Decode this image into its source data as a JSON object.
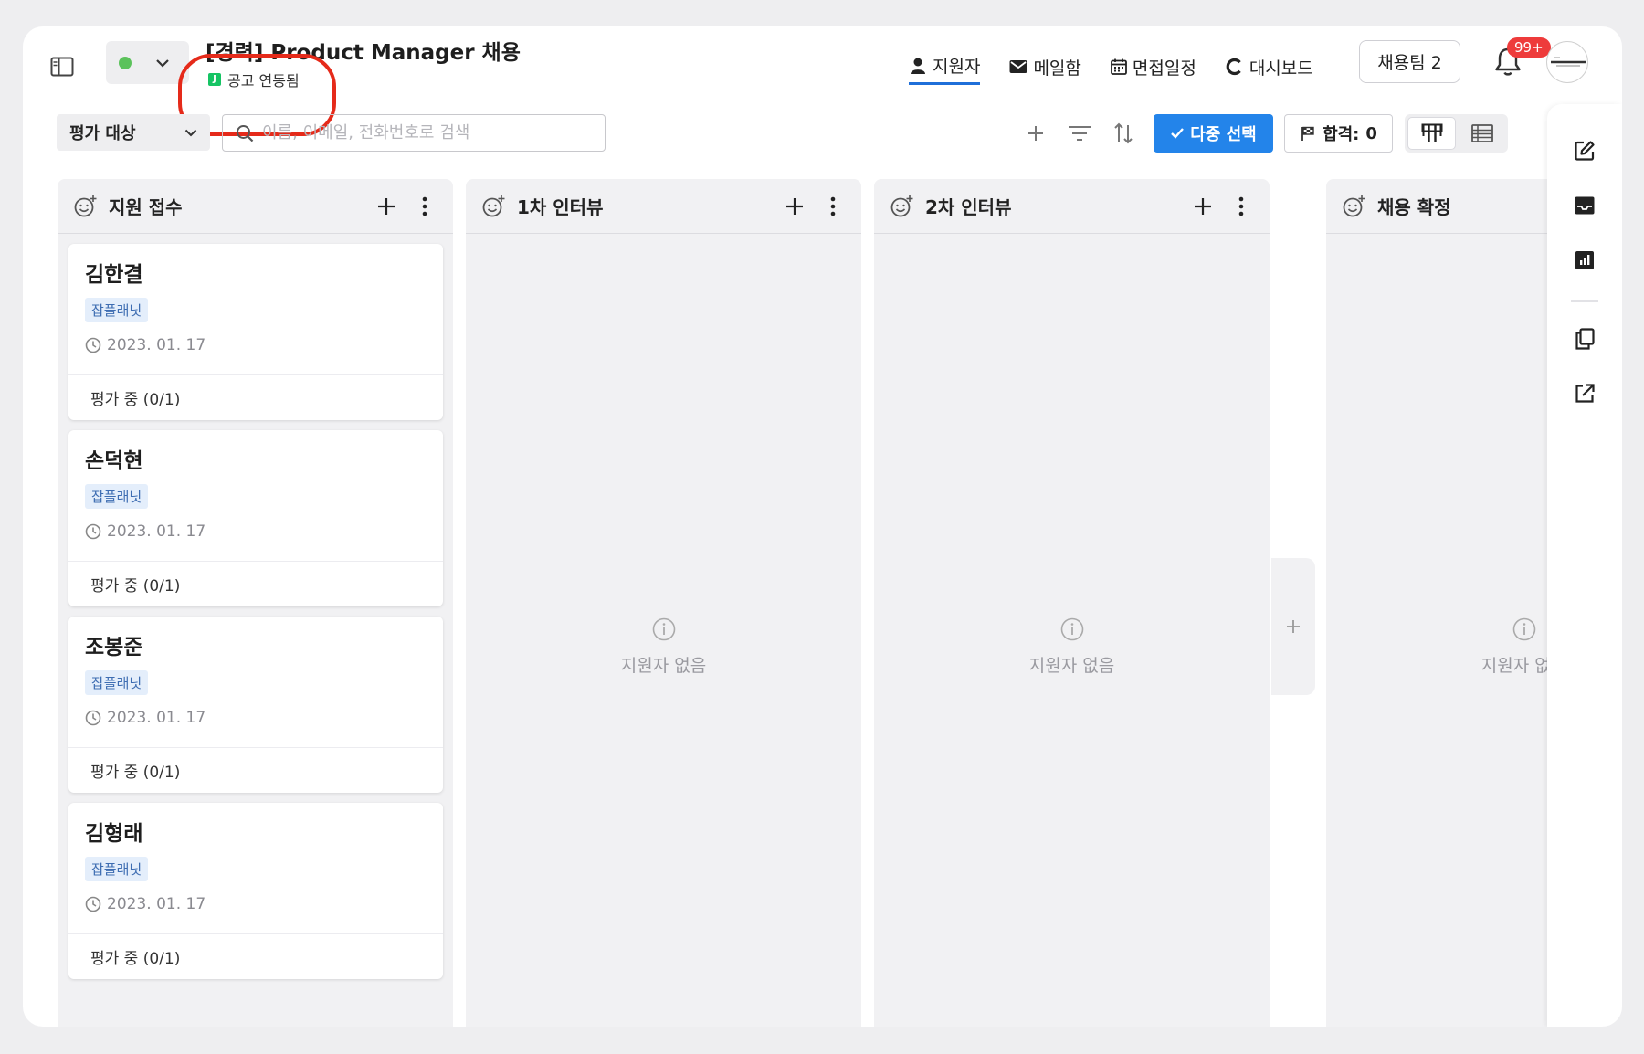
{
  "header": {
    "job_title": "[경력] Product Manager 채용",
    "linked_label": "공고 연동됨",
    "linked_logo": "J",
    "status_color": "#5bc25b",
    "nav": [
      {
        "label": "지원자",
        "icon": "person-icon"
      },
      {
        "label": "메일함",
        "icon": "mail-icon"
      },
      {
        "label": "면접일정",
        "icon": "calendar-icon"
      },
      {
        "label": "대시보드",
        "icon": "dashboard-icon"
      }
    ],
    "team_button": "채용팀 2",
    "notification_badge": "99+"
  },
  "toolbar": {
    "eval_select": "평가 대상",
    "search_placeholder": "이름, 이메일, 전화번호로 검색",
    "multi_select": "다중 선택",
    "pass_label": "합격:",
    "pass_count": "0"
  },
  "columns": [
    {
      "title": "지원 접수",
      "cards": [
        {
          "name": "김한결",
          "tag": "잡플래닛",
          "date": "2023. 01. 17",
          "status": "평가 중 (0/1)"
        },
        {
          "name": "손덕현",
          "tag": "잡플래닛",
          "date": "2023. 01. 17",
          "status": "평가 중 (0/1)"
        },
        {
          "name": "조봉준",
          "tag": "잡플래닛",
          "date": "2023. 01. 17",
          "status": "평가 중 (0/1)"
        },
        {
          "name": "김형래",
          "tag": "잡플래닛",
          "date": "2023. 01. 17",
          "status": "평가 중 (0/1)"
        }
      ]
    },
    {
      "title": "1차 인터뷰",
      "empty": "지원자 없음"
    },
    {
      "title": "2차 인터뷰",
      "empty": "지원자 없음"
    },
    {
      "title": "채용 확정",
      "empty": "지원자 없음"
    }
  ],
  "colors": {
    "accent": "#2384ea",
    "active_tab_underline": "#1f6fd9",
    "badge": "#ee3b3b",
    "highlight": "#e52a1a",
    "tag_bg": "#e4eefb",
    "tag_text": "#3e6db2"
  }
}
